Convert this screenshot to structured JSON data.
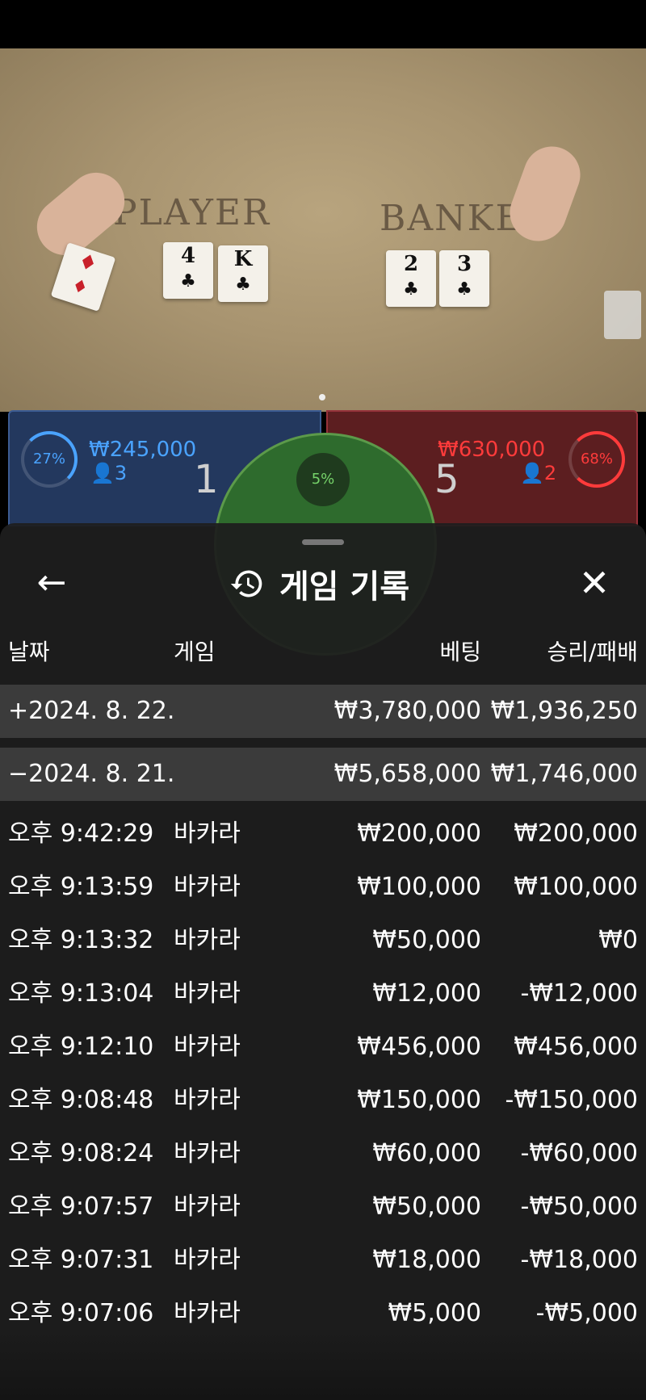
{
  "video": {
    "player_label": "PLAYER",
    "banker_label": "BANKER",
    "player_cards": [
      {
        "rank": "4",
        "suit": "♣"
      },
      {
        "rank": "K",
        "suit": "♣"
      }
    ],
    "banker_cards": [
      {
        "rank": "2",
        "suit": "♣"
      },
      {
        "rank": "3",
        "suit": "♣"
      }
    ]
  },
  "bet_panels": {
    "player": {
      "percent": "27%",
      "amount": "₩245,000",
      "bettors": "3",
      "score": "1",
      "color": "#4aa3ff"
    },
    "tie": {
      "percent": "5%",
      "color": "#76d36a"
    },
    "banker": {
      "percent": "68%",
      "amount": "₩630,000",
      "bettors": "2",
      "score": "5",
      "color": "#ff3b3b"
    }
  },
  "history": {
    "title": "게임 기록",
    "icons": {
      "back": "arrow-left-icon",
      "history": "history-icon",
      "close": "close-icon"
    },
    "headers": {
      "date": "날짜",
      "game": "게임",
      "bet": "베팅",
      "result": "승리/패배"
    },
    "groups": [
      {
        "date": "+2024. 8. 22.",
        "bet": "₩3,780,000",
        "result": "₩1,936,250"
      },
      {
        "date": "−2024. 8. 21.",
        "bet": "₩5,658,000",
        "result": "₩1,746,000"
      }
    ],
    "rows": [
      {
        "time": "오후 9:42:29",
        "game": "바카라",
        "bet": "₩200,000",
        "result": "₩200,000"
      },
      {
        "time": "오후 9:13:59",
        "game": "바카라",
        "bet": "₩100,000",
        "result": "₩100,000"
      },
      {
        "time": "오후 9:13:32",
        "game": "바카라",
        "bet": "₩50,000",
        "result": "₩0"
      },
      {
        "time": "오후 9:13:04",
        "game": "바카라",
        "bet": "₩12,000",
        "result": "-₩12,000"
      },
      {
        "time": "오후 9:12:10",
        "game": "바카라",
        "bet": "₩456,000",
        "result": "₩456,000"
      },
      {
        "time": "오후 9:08:48",
        "game": "바카라",
        "bet": "₩150,000",
        "result": "-₩150,000"
      },
      {
        "time": "오후 9:08:24",
        "game": "바카라",
        "bet": "₩60,000",
        "result": "-₩60,000"
      },
      {
        "time": "오후 9:07:57",
        "game": "바카라",
        "bet": "₩50,000",
        "result": "-₩50,000"
      },
      {
        "time": "오후 9:07:31",
        "game": "바카라",
        "bet": "₩18,000",
        "result": "-₩18,000"
      },
      {
        "time": "오후 9:07:06",
        "game": "바카라",
        "bet": "₩5,000",
        "result": "-₩5,000"
      }
    ]
  }
}
